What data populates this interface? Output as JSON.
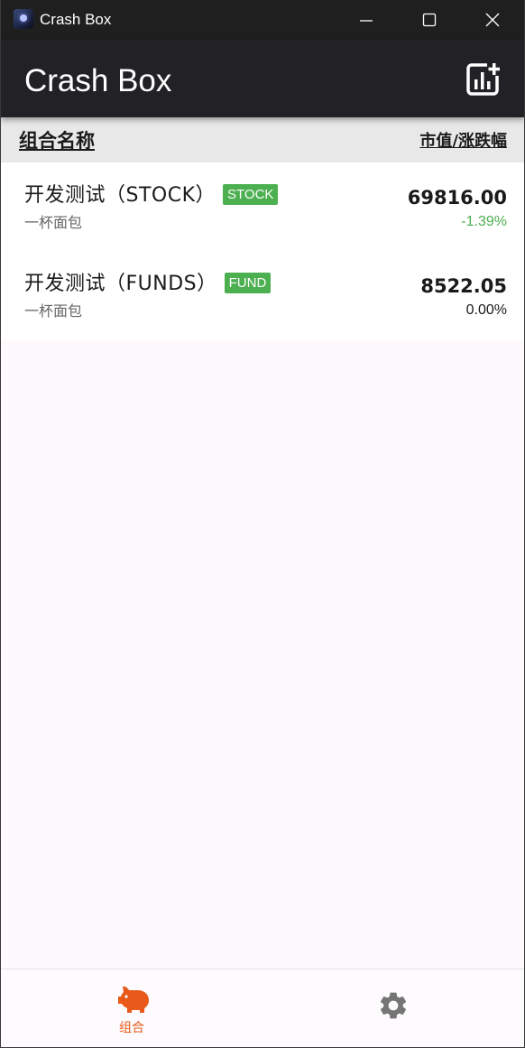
{
  "window": {
    "title": "Crash Box"
  },
  "appbar": {
    "title": "Crash Box",
    "action_icon": "add-chart-icon"
  },
  "columns": {
    "left": "组合名称",
    "right": "市值/涨跌幅"
  },
  "portfolios": [
    {
      "name": "开发测试（STOCK）",
      "badge": "STOCK",
      "owner": "一杯面包",
      "value": "69816.00",
      "change": "-1.39%",
      "change_color": "#4caf50"
    },
    {
      "name": "开发测试（FUNDS）",
      "badge": "FUND",
      "owner": "一杯面包",
      "value": "8522.05",
      "change": "0.00%",
      "change_color": "#1a1a1a"
    }
  ],
  "bottom_nav": {
    "items": [
      {
        "label": "组合",
        "icon": "piggy-bank-icon",
        "active": true
      },
      {
        "label": "",
        "icon": "gear-icon",
        "active": false
      }
    ],
    "active_color": "#e8591a"
  },
  "colors": {
    "titlebar": "#1f1f1f",
    "appbar": "#222226",
    "badge": "#4caf50",
    "accent": "#e8591a"
  }
}
